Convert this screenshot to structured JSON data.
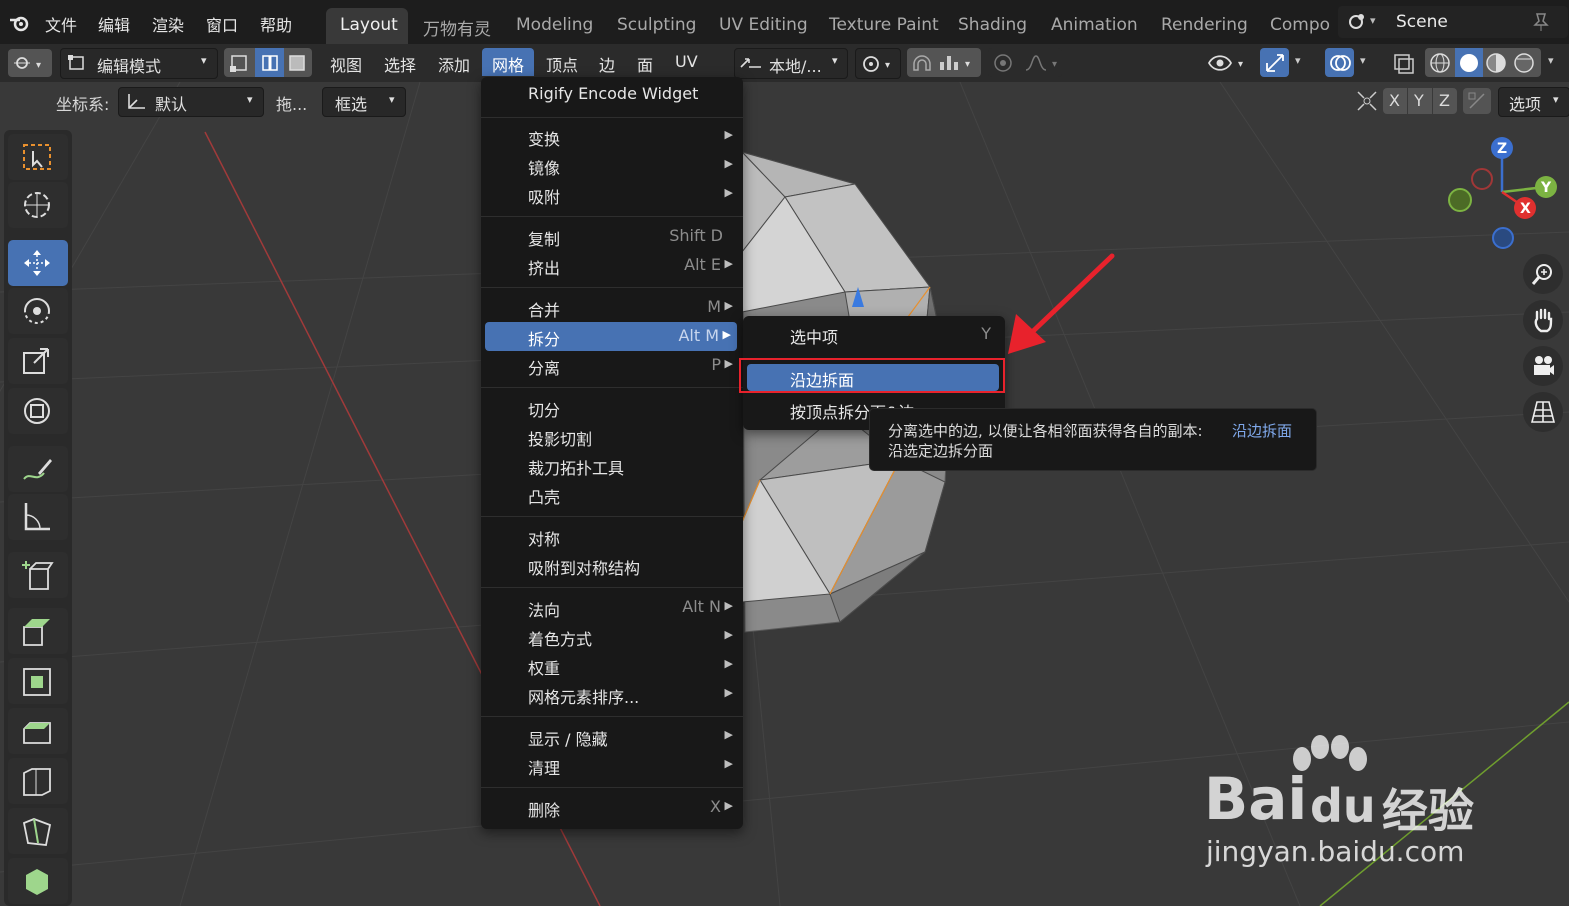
{
  "top_menu": [
    "文件",
    "编辑",
    "渲染",
    "窗口",
    "帮助"
  ],
  "workspace_tabs": [
    "Layout",
    "万物有灵",
    "Modeling",
    "Sculpting",
    "UV Editing",
    "Texture Paint",
    "Shading",
    "Animation",
    "Rendering",
    "Compo"
  ],
  "scene_name": "Scene",
  "header": {
    "mode": "编辑模式",
    "menus": [
      "视图",
      "选择",
      "添加",
      "网格",
      "顶点",
      "边",
      "面",
      "UV"
    ],
    "pivot": "本地/...",
    "options": "选项",
    "axes": [
      "X",
      "Y",
      "Z"
    ]
  },
  "subheader": {
    "coord_label": "坐标系:",
    "coord_value": "默认",
    "drag_label": "拖...",
    "select_mode": "框选"
  },
  "mesh_menu": {
    "items": [
      {
        "label": "Rigify Encode Widget",
        "shortcut": ""
      },
      {
        "label": "变换",
        "shortcut": ""
      },
      {
        "label": "镜像",
        "shortcut": ""
      },
      {
        "label": "吸附",
        "shortcut": ""
      },
      {
        "label": "复制",
        "shortcut": "Shift D"
      },
      {
        "label": "挤出",
        "shortcut": "Alt E"
      },
      {
        "label": "合并",
        "shortcut": "M"
      },
      {
        "label": "拆分",
        "shortcut": "Alt M"
      },
      {
        "label": "分离",
        "shortcut": "P"
      },
      {
        "label": "切分",
        "shortcut": ""
      },
      {
        "label": "投影切割",
        "shortcut": ""
      },
      {
        "label": "裁刀拓扑工具",
        "shortcut": ""
      },
      {
        "label": "凸壳",
        "shortcut": ""
      },
      {
        "label": "对称",
        "shortcut": ""
      },
      {
        "label": "吸附到对称结构",
        "shortcut": ""
      },
      {
        "label": "法向",
        "shortcut": "Alt N"
      },
      {
        "label": "着色方式",
        "shortcut": ""
      },
      {
        "label": "权重",
        "shortcut": ""
      },
      {
        "label": "网格元素排序...",
        "shortcut": ""
      },
      {
        "label": "显示 / 隐藏",
        "shortcut": ""
      },
      {
        "label": "清理",
        "shortcut": ""
      },
      {
        "label": "删除",
        "shortcut": "X"
      }
    ]
  },
  "split_submenu": {
    "items": [
      {
        "label": "选中项",
        "shortcut": "Y"
      },
      {
        "label": "沿边拆面",
        "shortcut": ""
      },
      {
        "label": "按顶点拆分面&边",
        "shortcut": ""
      }
    ]
  },
  "tooltip": {
    "text": "分离选中的边, 以便让各相邻面获得各自的副本:",
    "link": "沿边拆面",
    "line2": "沿选定边拆分面"
  },
  "gizmo_axes": [
    "Z",
    "Y",
    "X"
  ],
  "watermark": {
    "brand": "Bai",
    "brand2": "du",
    "cn": "经验",
    "url": "jingyan.baidu.com"
  },
  "colors": {
    "accent": "#4772b3",
    "highlight_border": "#e8222c",
    "arrow": "#e8222c"
  }
}
